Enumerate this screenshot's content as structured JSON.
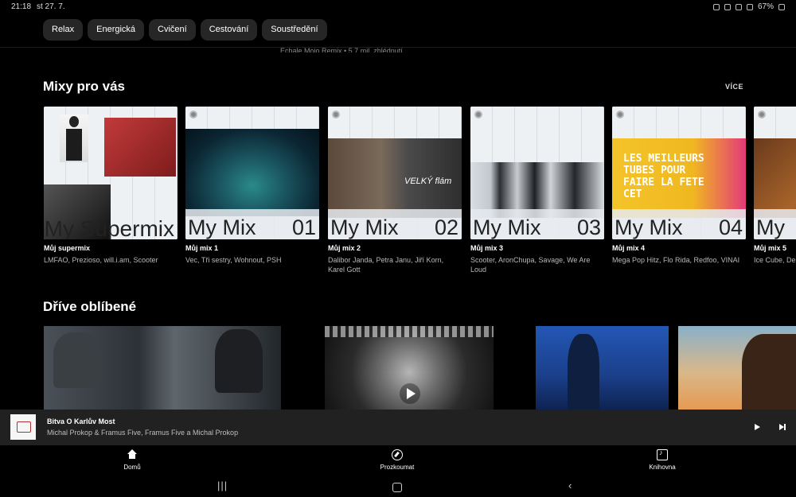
{
  "status_bar": {
    "time": "21:18",
    "date": "st 27. 7.",
    "battery": "67%"
  },
  "chips": [
    "Relax",
    "Energická",
    "Cvičení",
    "Cestování",
    "Soustředění"
  ],
  "cutoff_text": "Echale Mojo Remix • 5,7 mil. zhlédnutí",
  "mixes_section": {
    "title": "Mixy pro vás",
    "more_label": "VÍCE",
    "cards": [
      {
        "art_title": "My Supermix",
        "art_number": "",
        "title": "Můj supermix",
        "subtitle": "LMFAO, Prezioso, will.i.am, Scooter"
      },
      {
        "art_title": "My Mix",
        "art_number": "01",
        "title": "Můj mix 1",
        "subtitle": "Vec, Tři sestry, Wohnout, PSH"
      },
      {
        "art_title": "My Mix",
        "art_number": "02",
        "title": "Můj mix 2",
        "subtitle": "Dalibor Janda, Petra Janu, Jiří Korn, Karel Gott",
        "art_text": "VELKÝ flám"
      },
      {
        "art_title": "My Mix",
        "art_number": "03",
        "title": "Můj mix 3",
        "subtitle": "Scooter, AronChupa, Savage, We Are Loud"
      },
      {
        "art_title": "My Mix",
        "art_number": "04",
        "title": "Můj mix 4",
        "subtitle": "Mega Pop Hitz, Flo Rida, Redfoo, VINAI",
        "art_text": "LES MEILLEURS TUBES POUR FAIRE LA FETE CET"
      },
      {
        "art_title": "My",
        "art_number": "",
        "title": "Můj mix 5",
        "subtitle": "Ice Cube, De Hill, Control I"
      }
    ]
  },
  "liked_section": {
    "title": "Dříve oblíbené"
  },
  "player": {
    "title": "Bitva O Karlův Most",
    "artist": "Michal Prokop & Framus Five, Framus Five a Michal Prokop"
  },
  "nav": {
    "home": "Domů",
    "explore": "Prozkoumat",
    "library": "Knihovna"
  },
  "colors": {
    "background": "#000000",
    "chip": "#262626",
    "player": "#212121"
  }
}
